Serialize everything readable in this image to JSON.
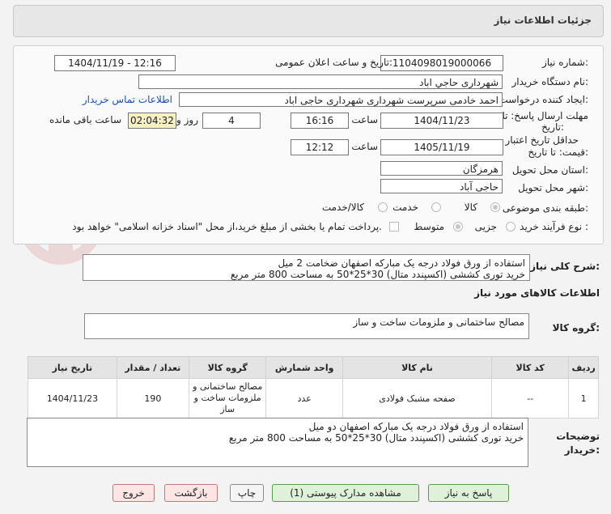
{
  "header": {
    "title": "جزئیات اطلاعات نیاز"
  },
  "form": {
    "need_number_label": "شماره نیاز:",
    "need_number": "1104098019000066",
    "announce_label": "تاریخ و ساعت اعلان عمومی:",
    "announce_value": "1404/11/19 - 12:16",
    "buyer_org_label": "نام دستگاه خریدار:",
    "buyer_org": "شهرداری حاجي اباد",
    "creator_label": "ایجاد کننده درخواست:",
    "creator": "احمد خادمی سرپرست شهرداری شهرداری حاجی اباد",
    "contact_link": "اطلاعات تماس خریدار",
    "deadline_label_1": "مهلت ارسال پاسخ: تا",
    "deadline_label_2": "تاریخ:",
    "deadline_date": "1404/11/23",
    "time_label": "ساعت",
    "deadline_time": "16:16",
    "days_value": "4",
    "days_label": "روز و",
    "remaining_time": "02:04:32",
    "remaining_label": "ساعت باقی مانده",
    "validity_label_1": "حداقل تاریخ اعتبار",
    "validity_label_2": "قیمت: تا تاریخ:",
    "validity_date": "1405/11/19",
    "validity_time": "12:12",
    "province_label": "استان محل تحویل:",
    "province": "هرمزگان",
    "city_label": "شهر محل تحویل:",
    "city": "حاجی آباد",
    "category_label": "طبقه بندی موضوعی:",
    "category_options": [
      "کالا",
      "خدمت",
      "کالا/خدمت"
    ],
    "process_label": "نوع فرآیند خرید :",
    "process_options": [
      "جزیی",
      "متوسط"
    ],
    "payment_note": "پرداخت تمام یا بخشی از مبلغ خرید،از محل \"اسناد خزانه اسلامی\" خواهد بود."
  },
  "summary": {
    "label": "شرح کلی نیاز:",
    "text_line1": "استفاده از ورق فولاد درجه یک مبارکه اصفهان ضخامت 2 میل",
    "text_line2": "خرید توری کششی (اکسپندد متال) 30*25*50 به مساحت 800 متر مربع"
  },
  "goods_info": {
    "title": "اطلاعات کالاهای مورد نیاز",
    "group_label": "گروه کالا:",
    "group_value": "مصالح ساختمانی و ملزومات ساخت و ساز"
  },
  "table": {
    "headers": [
      "ردیف",
      "کد کالا",
      "نام کالا",
      "واحد شمارش",
      "گروه کالا",
      "تعداد / مقدار",
      "تاریخ نیاز"
    ],
    "rows": [
      {
        "row": "1",
        "code": "--",
        "name": "صفحه مشبک فولادی",
        "unit": "عدد",
        "group": "مصالح ساختمانی و ملزومات ساخت و ساز",
        "qty": "190",
        "date": "1404/11/23"
      }
    ]
  },
  "buyer_notes": {
    "label_1": "توضیحات",
    "label_2": "خریدار:",
    "text_line1": "استفاده از ورق فولاد درجه یک مبارکه اصفهان دو میل",
    "text_line2": "خرید توری کششی (اکسپندد متال) 30*25*50 به مساحت 800 متر مربع"
  },
  "buttons": {
    "reply": "پاسخ به نیاز",
    "attachments": "مشاهده مدارک پیوستی (1)",
    "print": "چاپ",
    "back": "بازگشت",
    "exit": "خروج"
  },
  "watermark": {
    "text": "AriaTender.neT"
  }
}
